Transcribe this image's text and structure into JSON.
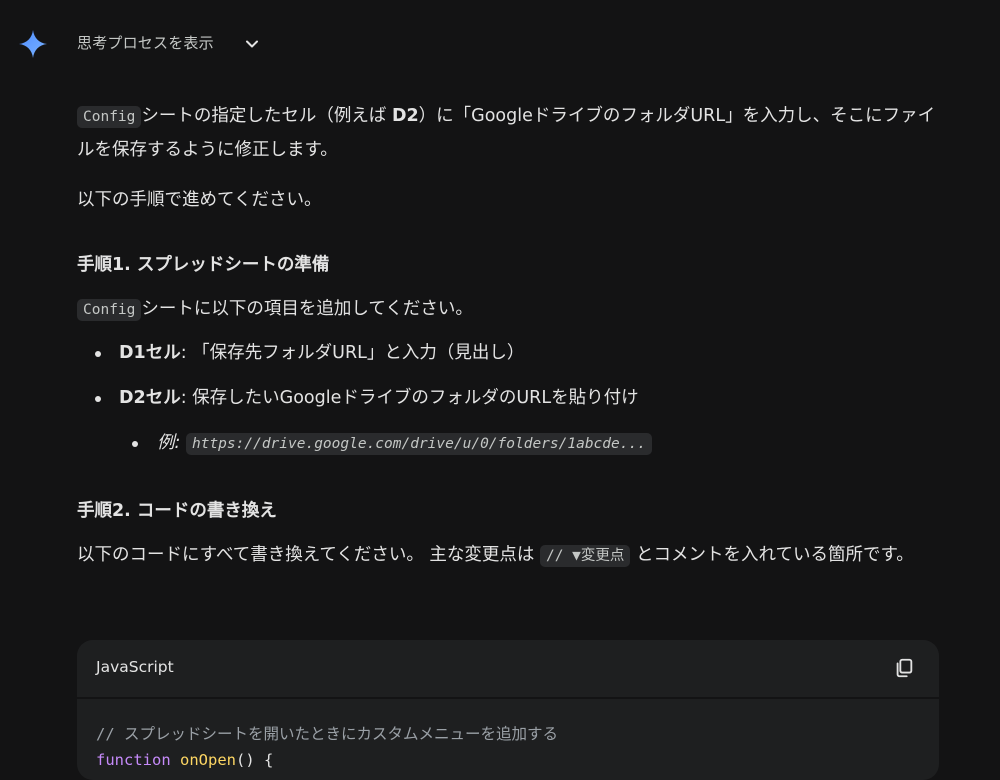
{
  "thinking": {
    "label": "思考プロセスを表示"
  },
  "intro": {
    "code": "Config",
    "text": "シートの指定したセル（例えば ",
    "cell": "D2",
    "text2": "）に「GoogleドライブのフォルダURL」を入力し、そこにファイルを保存するように修正します。"
  },
  "steps_intro": "以下の手順で進めてください。",
  "step1": {
    "heading": "手順1. スプレッドシートの準備",
    "code": "Config",
    "text": "シートに以下の項目を追加してください。",
    "items": [
      {
        "label": "D1セル",
        "text": ": 「保存先フォルダURL」と入力（見出し）"
      },
      {
        "label": "D2セル",
        "text": ": 保存したいGoogleドライブのフォルダのURLを貼り付け"
      }
    ],
    "example": {
      "label": "例:",
      "code": "https://drive.google.com/drive/u/0/folders/1abcde..."
    }
  },
  "step2": {
    "heading": "手順2. コードの書き換え",
    "text_a": "以下のコードにすべて書き換えてください。 主な変更点は ",
    "code": "// ▼変更点",
    "text_b": " とコメントを入れている箇所です。"
  },
  "codeblock": {
    "language": "JavaScript",
    "line1": "// スプレッドシートを開いたときにカスタムメニューを追加する",
    "line2_kw": "function",
    "line2_fn": "onOpen",
    "line2_rest": "() {"
  },
  "icons": {
    "spark": "gemini-spark-icon",
    "chevron": "chevron-down-icon",
    "copy": "copy-icon"
  },
  "colors": {
    "background": "#131314",
    "text": "#e3e3e3",
    "keyword": "#c58af9",
    "function": "#fdd663",
    "comment": "#9aa0a6"
  }
}
